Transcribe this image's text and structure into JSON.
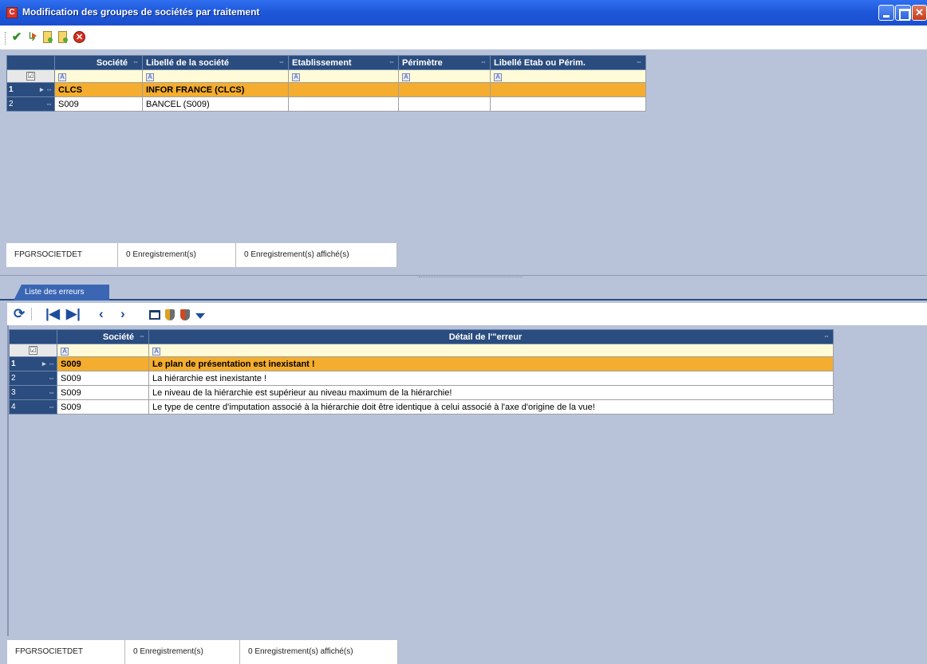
{
  "window": {
    "title": "Modification des groupes de sociétés par traitement",
    "app_icon": "C"
  },
  "toolbar": {
    "icons": [
      "check-icon",
      "run-icon",
      "export-doc-icon",
      "import-doc-icon",
      "stop-icon"
    ]
  },
  "top_grid": {
    "columns": [
      "Société",
      "Libellé de la société",
      "Etablissement",
      "Périmètre",
      "Libellé Etab ou Périm."
    ],
    "rows": [
      {
        "num": "1",
        "societe": "CLCS",
        "libelle": "INFOR FRANCE (CLCS)",
        "etab": "",
        "perimetre": "",
        "libelle_etab": "",
        "selected": true
      },
      {
        "num": "2",
        "societe": "S009",
        "libelle": "BANCEL (S009)",
        "etab": "",
        "perimetre": "",
        "libelle_etab": "",
        "selected": false
      }
    ]
  },
  "top_status": {
    "table_name": "FPGRSOCIETDET",
    "records": "0 Enregistrement(s)",
    "displayed": "0 Enregistrement(s) affiché(s)"
  },
  "tab": {
    "label": "Liste des erreurs"
  },
  "bottom_grid": {
    "columns": [
      "Société",
      "Détail de l'\"erreur"
    ],
    "rows": [
      {
        "num": "1",
        "societe": "S009",
        "detail": "Le plan de présentation est inexistant !",
        "selected": true
      },
      {
        "num": "2",
        "societe": "S009",
        "detail": "La hiérarchie est inexistante !",
        "selected": false
      },
      {
        "num": "3",
        "societe": "S009",
        "detail": "Le niveau de la hiérarchie est supérieur au niveau maximum de la hiérarchie!",
        "selected": false
      },
      {
        "num": "4",
        "societe": "S009",
        "detail": "Le type de centre d'imputation associé à la hiérarchie doit être identique à celui associé à l'axe d'origine de la vue!",
        "selected": false
      }
    ]
  },
  "bottom_status": {
    "table_name": "FPGRSOCIETDET",
    "records": "0 Enregistrement(s)",
    "displayed": "0 Enregistrement(s) affiché(s)"
  },
  "colors": {
    "title_bar": "#1e57d8",
    "header_bg": "#2a4c7e",
    "selected_row": "#f4ad2e",
    "filter_row": "#fffbd9",
    "background": "#b8c3d9"
  }
}
